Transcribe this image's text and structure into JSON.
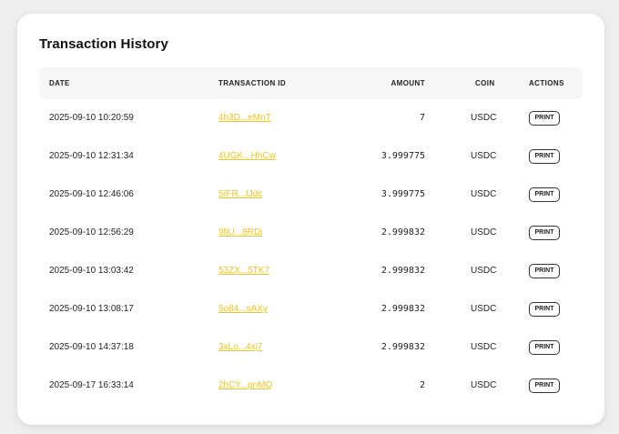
{
  "card": {
    "title": "Transaction History"
  },
  "table": {
    "headers": {
      "date": "DATE",
      "transaction_id": "TRANSACTION ID",
      "amount": "AMOUNT",
      "coin": "COIN",
      "actions": "ACTIONS"
    },
    "rows": [
      {
        "date": "2025-09-10 10:20:59",
        "tx": "4h3D...eMnT",
        "amount": "7",
        "coin": "USDC",
        "action": "PRINT"
      },
      {
        "date": "2025-09-10 12:31:34",
        "tx": "4UGK...HhCw",
        "amount": "3.999775",
        "coin": "USDC",
        "action": "PRINT"
      },
      {
        "date": "2025-09-10 12:46:06",
        "tx": "5IFR...tJdc",
        "amount": "3.999775",
        "coin": "USDC",
        "action": "PRINT"
      },
      {
        "date": "2025-09-10 12:56:29",
        "tx": "9fiU...8RDi",
        "amount": "2.999832",
        "coin": "USDC",
        "action": "PRINT"
      },
      {
        "date": "2025-09-10 13:03:42",
        "tx": "53ZX...5TK7",
        "amount": "2.999832",
        "coin": "USDC",
        "action": "PRINT"
      },
      {
        "date": "2025-09-10 13:08:17",
        "tx": "5o84...sAXy",
        "amount": "2.999832",
        "coin": "USDC",
        "action": "PRINT"
      },
      {
        "date": "2025-09-10 14:37:18",
        "tx": "3xLo...4xj7",
        "amount": "2.999832",
        "coin": "USDC",
        "action": "PRINT"
      },
      {
        "date": "2025-09-17 16:33:14",
        "tx": "2hCY...pnMQ",
        "amount": "2",
        "coin": "USDC",
        "action": "PRINT"
      }
    ]
  },
  "colors": {
    "link": "#f0c419",
    "background": "#eeeeee",
    "card": "#ffffff",
    "header_row": "#f6f6f6"
  }
}
